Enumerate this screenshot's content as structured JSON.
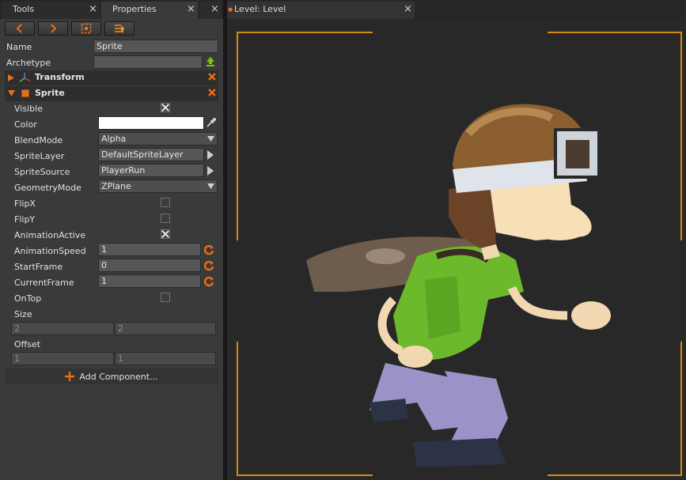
{
  "left_tabs": {
    "tools": "Tools",
    "properties": "Properties",
    "close": "×"
  },
  "right_tab": {
    "dot": "●",
    "title": "Level: Level",
    "close": "×"
  },
  "colors": {
    "accent": "#e07020",
    "frame": "#d58a17",
    "upload": "#6dd400",
    "remove": "#f06a10"
  },
  "toolbar": {
    "icons": [
      "back-arrow-icon",
      "forward-arrow-icon",
      "select-frame-icon",
      "list-edit-icon"
    ]
  },
  "header_props": {
    "name_label": "Name",
    "name_value": "Sprite",
    "archetype_label": "Archetype",
    "archetype_value": ""
  },
  "sections": {
    "transform": "Transform",
    "sprite": "Sprite"
  },
  "sprite_props": {
    "visible": {
      "label": "Visible",
      "checked": true
    },
    "color": {
      "label": "Color",
      "value": "#ffffff"
    },
    "blend_mode": {
      "label": "BlendMode",
      "value": "Alpha"
    },
    "sprite_layer": {
      "label": "SpriteLayer",
      "value": "DefaultSpriteLayer"
    },
    "sprite_source": {
      "label": "SpriteSource",
      "value": "PlayerRun"
    },
    "geometry_mode": {
      "label": "GeometryMode",
      "value": "ZPlane"
    },
    "flip_x": {
      "label": "FlipX",
      "checked": false
    },
    "flip_y": {
      "label": "FlipY",
      "checked": false
    },
    "animation_active": {
      "label": "AnimationActive",
      "checked": true
    },
    "animation_speed": {
      "label": "AnimationSpeed",
      "value": "1"
    },
    "start_frame": {
      "label": "StartFrame",
      "value": "0"
    },
    "current_frame": {
      "label": "CurrentFrame",
      "value": "1"
    },
    "on_top": {
      "label": "OnTop",
      "checked": false
    },
    "size": {
      "label": "Size",
      "x": "2",
      "y": "2"
    },
    "offset": {
      "label": "Offset",
      "x": "1",
      "y": "1"
    }
  },
  "add_component": {
    "icon": "plus-icon",
    "label": "Add Component..."
  }
}
